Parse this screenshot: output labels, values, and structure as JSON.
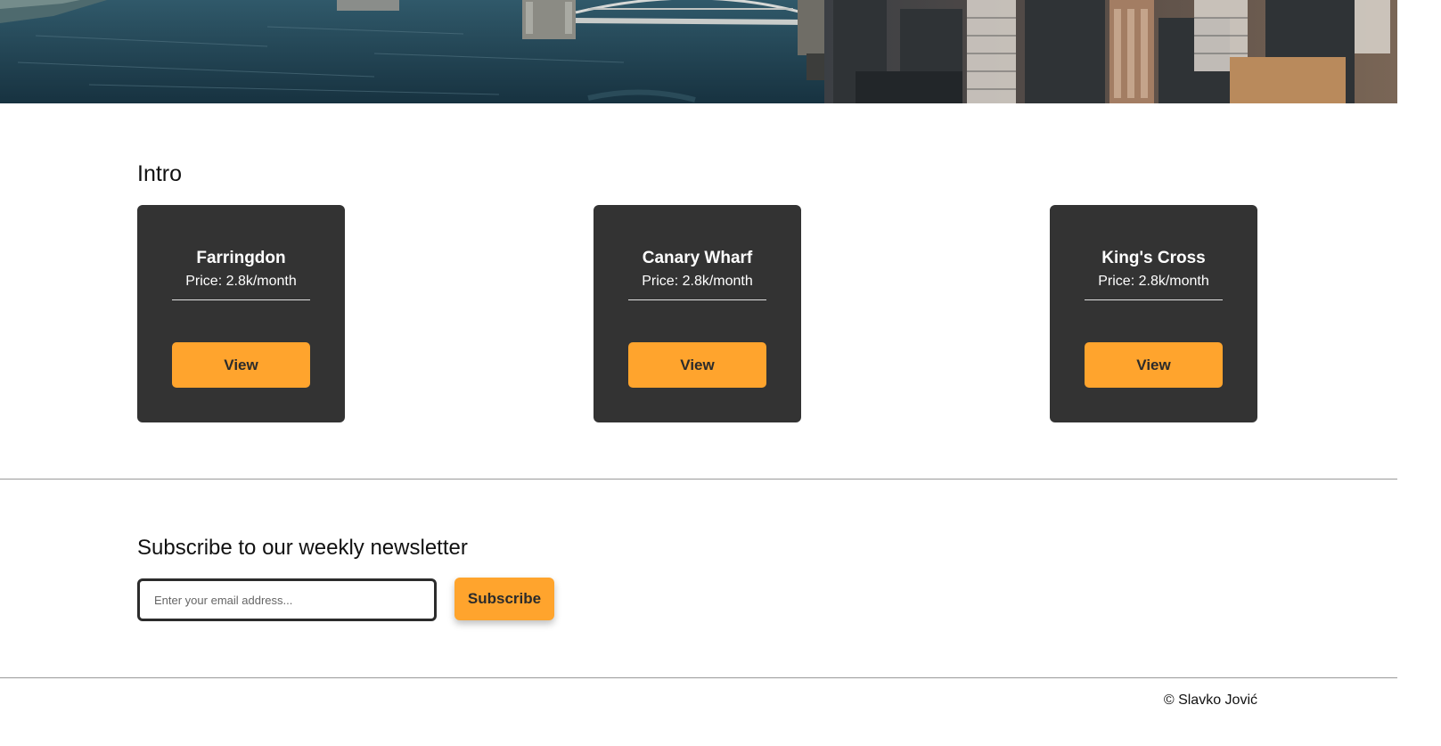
{
  "intro": {
    "title": "Intro",
    "cards": [
      {
        "name": "Farringdon",
        "price": "Price: 2.8k/month",
        "button": "View"
      },
      {
        "name": "Canary Wharf",
        "price": "Price: 2.8k/month",
        "button": "View"
      },
      {
        "name": "King's Cross",
        "price": "Price: 2.8k/month",
        "button": "View"
      }
    ]
  },
  "newsletter": {
    "title": "Subscribe to our weekly newsletter",
    "email_placeholder": "Enter your email address...",
    "email_value": "",
    "subscribe_label": "Subscribe"
  },
  "footer": {
    "copyright": "© Slavko Jović"
  },
  "colors": {
    "accent": "#ffa42d",
    "card_bg": "#333333",
    "hero_water": "#1f3e4c"
  }
}
